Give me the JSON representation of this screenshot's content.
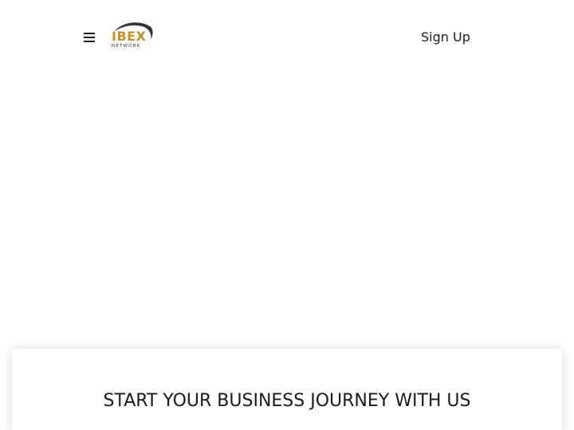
{
  "header": {
    "menu_icon": "hamburger-icon",
    "logo": {
      "name": "IBEX",
      "tagline": "NETWORK",
      "accent_color": "#c8922a",
      "swoosh_color": "#333333"
    },
    "signup_label": "Sign Up"
  },
  "main": {
    "section_title": "START YOUR BUSINESS JOURNEY WITH US"
  }
}
